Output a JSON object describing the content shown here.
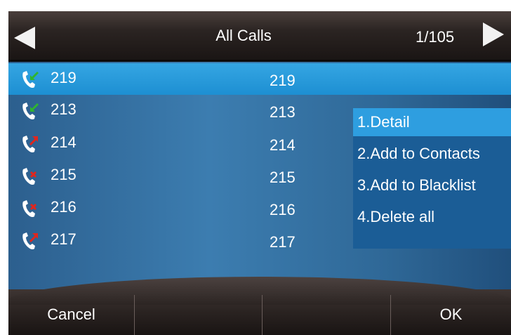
{
  "title_bar": {
    "title": "All Calls",
    "page_indicator": "1/105"
  },
  "call_list": [
    {
      "name": "219",
      "number": "219",
      "type": "received",
      "selected": true
    },
    {
      "name": "213",
      "number": "213",
      "type": "received",
      "selected": false
    },
    {
      "name": "214",
      "number": "214",
      "type": "dialed",
      "selected": false
    },
    {
      "name": "215",
      "number": "215",
      "type": "missed",
      "selected": false
    },
    {
      "name": "216",
      "number": "216",
      "type": "missed",
      "selected": false
    },
    {
      "name": "217",
      "number": "217",
      "type": "dialed",
      "selected": false
    }
  ],
  "option_menu": [
    {
      "label": "1.Detail",
      "active": true
    },
    {
      "label": "2.Add to Contacts",
      "active": false
    },
    {
      "label": "3.Add to Blacklist",
      "active": false
    },
    {
      "label": "4.Delete all",
      "active": false
    }
  ],
  "softkeys": [
    "Cancel",
    "",
    "",
    "OK"
  ],
  "colors": {
    "selection": "#35a6e3",
    "received_arrow": "#2fb52f",
    "dialed_arrow": "#e0261d",
    "missed_mark": "#e0261d"
  }
}
